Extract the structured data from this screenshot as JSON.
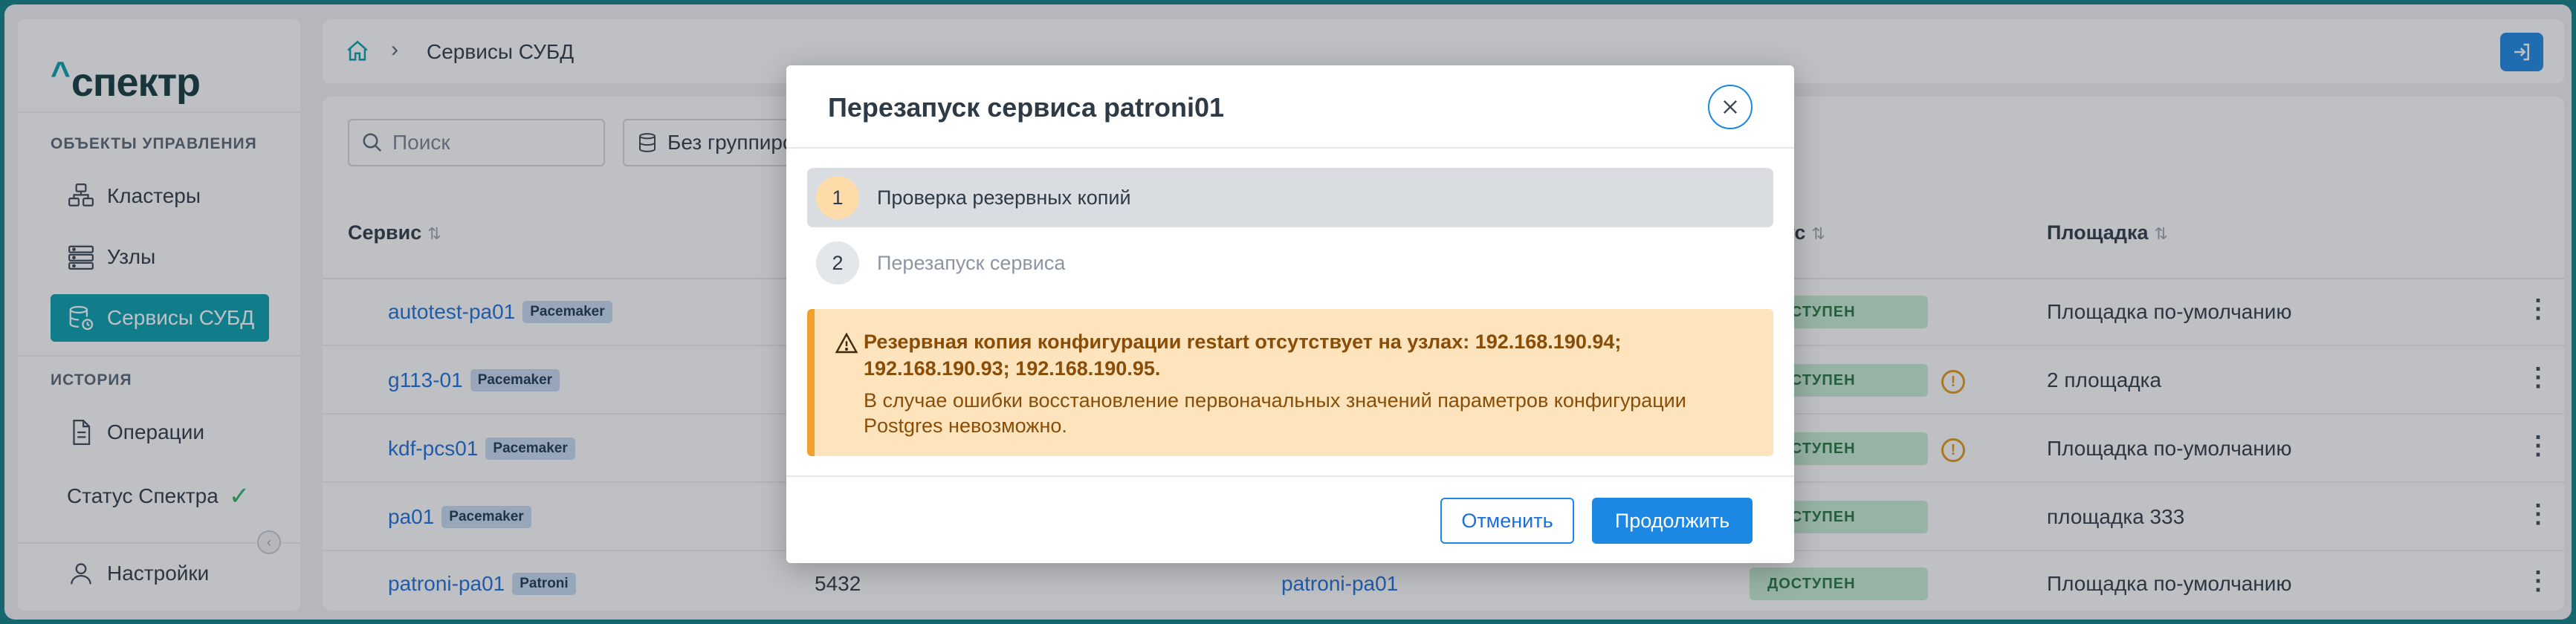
{
  "sidebar": {
    "logo_caret": "^",
    "logo_text": "спектр",
    "section_management": "ОБЪЕКТЫ УПРАВЛЕНИЯ",
    "items_management": [
      {
        "label": "Кластеры",
        "icon": "cluster-icon"
      },
      {
        "label": "Узлы",
        "icon": "server-icon"
      },
      {
        "label": "Сервисы СУБД",
        "icon": "database-icon",
        "active": true
      }
    ],
    "section_history": "ИСТОРИЯ",
    "items_history": [
      {
        "label": "Операции",
        "icon": "document-icon"
      }
    ],
    "status_label": "Статус Спектра",
    "settings_label": "Настройки",
    "accent_color": "#0aa0ad"
  },
  "topbar": {
    "breadcrumb": "Сервисы СУБД"
  },
  "toolbar": {
    "search_placeholder": "Поиск",
    "grouping_label": "Без группиро"
  },
  "table": {
    "headers": {
      "service": "Сервис",
      "status": "ус",
      "site": "Площадка"
    },
    "rows": [
      {
        "service": "autotest-pa01",
        "tag": "Pacemaker",
        "status": "ДОСТУПЕН",
        "warn": false,
        "site": "Площадка по-умолчанию"
      },
      {
        "service": "g113-01",
        "tag": "Pacemaker",
        "status": "ДОСТУПЕН",
        "warn": true,
        "site": "2 площадка"
      },
      {
        "service": "kdf-pcs01",
        "tag": "Pacemaker",
        "status": "ДОСТУПЕН",
        "warn": true,
        "site": "Площадка по-умолчанию"
      },
      {
        "service": "pa01",
        "tag": "Pacemaker",
        "status": "ДОСТУПЕН",
        "warn": false,
        "site": "площадка 333"
      },
      {
        "service": "patroni-pa01",
        "tag": "Patroni",
        "port": "5432",
        "cluster": "patroni-pa01",
        "status": "ДОСТУПЕН",
        "warn": false,
        "site": "Площадка по-умолчанию"
      }
    ]
  },
  "modal": {
    "title": "Перезапуск сервиса patroni01",
    "steps": [
      {
        "num": "1",
        "label": "Проверка резервных копий"
      },
      {
        "num": "2",
        "label": "Перезапуск сервиса"
      }
    ],
    "alert": {
      "title": "Резервная копия конфигурации restart отсутствует на узлах: 192.168.190.94; 192.168.190.93; 192.168.190.95.",
      "text": "В случае ошибки восстановление первоначальных значений параметров конфигурации Postgres невозможно."
    },
    "cancel_label": "Отменить",
    "continue_label": "Продолжить"
  }
}
